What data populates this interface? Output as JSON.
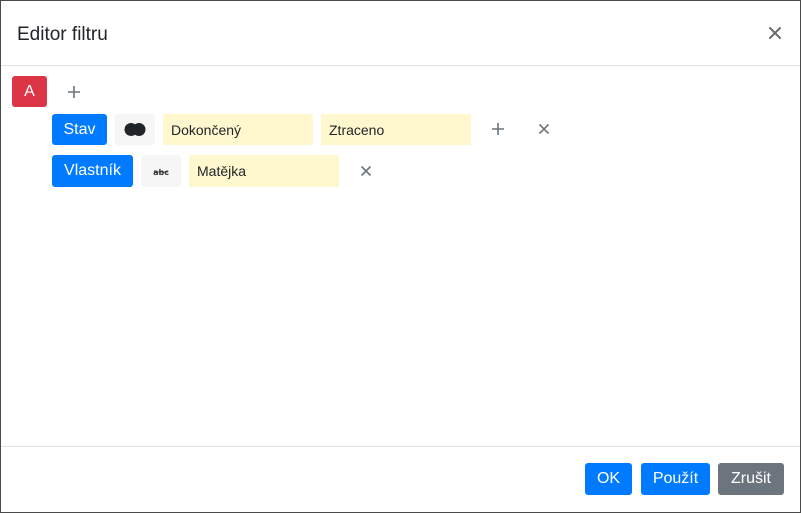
{
  "dialog": {
    "title": "Editor filtru",
    "close_icon": "close-icon"
  },
  "group": {
    "label": "A",
    "add_icon": "plus-icon"
  },
  "rules": [
    {
      "field": "Stav",
      "operator_icon": "two-circles-icon",
      "values": [
        "Dokončený",
        "Ztraceno"
      ],
      "add_value_icon": "plus-icon",
      "remove_icon": "close-icon"
    },
    {
      "field": "Vlastník",
      "operator_icon": "abc-text-match-icon",
      "values": [
        "Matějka"
      ],
      "remove_icon": "close-icon"
    }
  ],
  "footer": {
    "ok_label": "OK",
    "apply_label": "Použít",
    "cancel_label": "Zrušit"
  },
  "colors": {
    "primary": "#007bff",
    "danger": "#dc3545",
    "secondary": "#6c757d",
    "input_highlight": "#fff8cf"
  }
}
